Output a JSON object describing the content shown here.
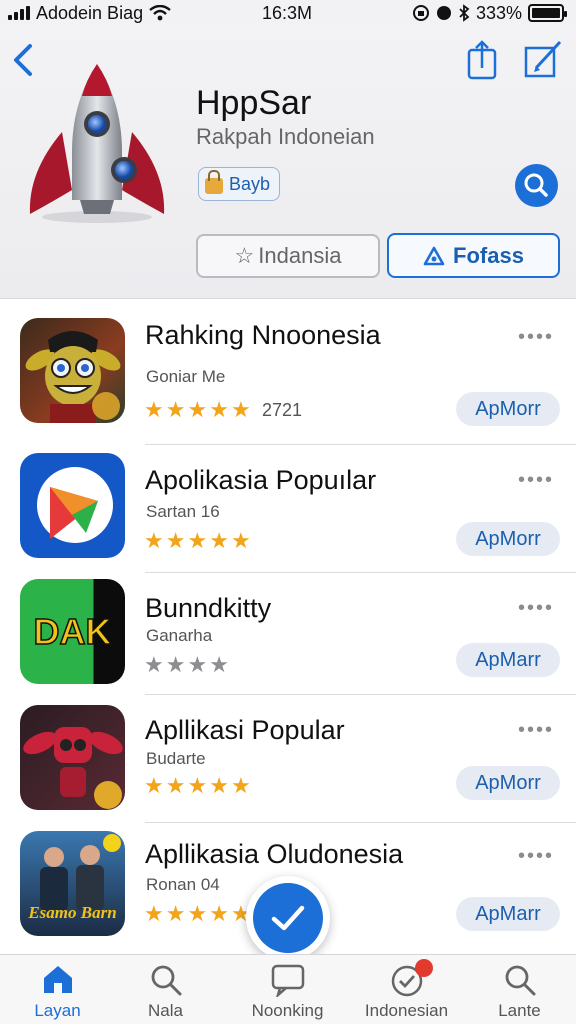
{
  "status_bar": {
    "carrier": "Adodein Biag",
    "time": "16:3M",
    "battery": "333%"
  },
  "header": {
    "app_name": "HppSar",
    "app_subtitle": "Rakpah Indoneian",
    "badge_label": "Bayb",
    "segment_left": "Indansia",
    "segment_right": "Fofass"
  },
  "apps": [
    {
      "title": "Rahking Nnoonesia",
      "subtitle": "Goniar Me",
      "rating": 5,
      "count": "2721",
      "button": "ApMorr"
    },
    {
      "title": "Apolikasia Popuılar",
      "subtitle": "Sartan 16",
      "rating": 5,
      "count": "",
      "button": "ApMorr"
    },
    {
      "title": "Bunndkitty",
      "subtitle": "Ganarha",
      "rating": 0,
      "count": "",
      "button": "ApMarr"
    },
    {
      "title": "Apllikasi Popular",
      "subtitle": "Budarte",
      "rating": 5,
      "count": "",
      "button": "ApMorr"
    },
    {
      "title": "Apllikasia Oludonesia",
      "subtitle": "Ronan 04",
      "rating": 5,
      "count": "",
      "button": "ApMarr"
    }
  ],
  "thumb_texts": {
    "dak": "DAK",
    "movie": "Esamo Barn"
  },
  "tabs": [
    {
      "label": "Layan",
      "icon": "home-icon"
    },
    {
      "label": "Nala",
      "icon": "search-icon"
    },
    {
      "label": "Noonking",
      "icon": "chat-icon"
    },
    {
      "label": "Indonesian",
      "icon": "badge-check-icon"
    },
    {
      "label": "Lante",
      "icon": "search-icon"
    }
  ],
  "colors": {
    "accent": "#1c6fd6",
    "star": "#f2a51a",
    "badge": "#e23a2f"
  }
}
